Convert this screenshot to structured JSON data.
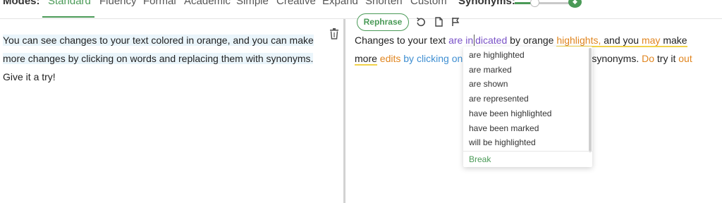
{
  "modes": {
    "label": "Modes:",
    "items": [
      "Standard",
      "Fluency",
      "Formal",
      "Academic",
      "Simple",
      "Creative",
      "Expand",
      "Shorten",
      "Custom"
    ],
    "active": "Standard",
    "synonyms_label": "Synonyms:",
    "synonyms_level_percent": 30
  },
  "left": {
    "line1": "You can see changes to your text colored in orange, and you can make",
    "line2": "more changes by clicking on words and replacing them with synonyms.",
    "line3": "Give it a try!"
  },
  "toolbar": {
    "rephrase_label": "Rephrase"
  },
  "right": {
    "p1": "Changes to your text ",
    "p2": "are ",
    "p3": "in",
    "p4": "dicated",
    "p5": " by orange ",
    "p6": "highlights,",
    "p7": " and you ",
    "p8": "may",
    "p9": " make",
    "p10": "more",
    "p11": " ",
    "p12": "edits",
    "p13": " ",
    "p14": "by clicking on",
    "p15": "synonyms.",
    "p16": " ",
    "p17": "Do",
    "p18": " try it ",
    "p19": "out"
  },
  "dropdown": {
    "items": [
      "are highlighted",
      "are marked",
      "are shown",
      "are represented",
      "have been highlighted",
      "have been marked",
      "will be highlighted"
    ],
    "break_label": "Break"
  },
  "colors": {
    "accent": "#4a9a57",
    "orange": "#e0851f",
    "purple": "#7a52c7",
    "blue": "#3f8fd2"
  }
}
